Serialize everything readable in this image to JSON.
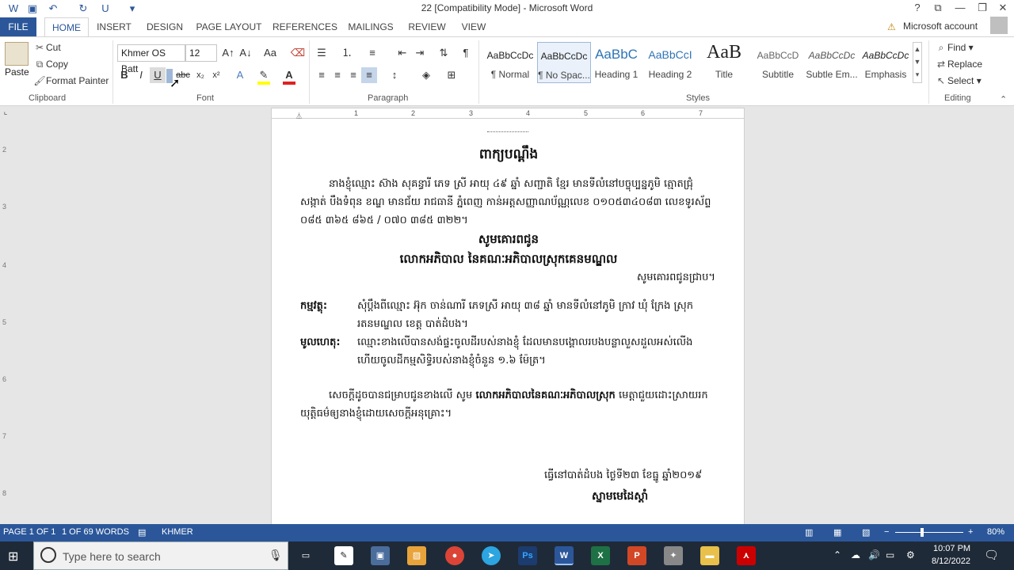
{
  "window": {
    "title": "22 [Compatibility Mode] - Microsoft Word",
    "help": "?",
    "account": "Microsoft account"
  },
  "tabs": [
    {
      "label": "FILE"
    },
    {
      "label": "HOME"
    },
    {
      "label": "INSERT"
    },
    {
      "label": "DESIGN"
    },
    {
      "label": "PAGE LAYOUT"
    },
    {
      "label": "REFERENCES"
    },
    {
      "label": "MAILINGS"
    },
    {
      "label": "REVIEW"
    },
    {
      "label": "VIEW"
    }
  ],
  "clipboard": {
    "paste": "Paste",
    "cut": "Cut",
    "copy": "Copy",
    "format_painter": "Format Painter",
    "group": "Clipboard"
  },
  "font": {
    "family": "Khmer OS Batt",
    "size": "12",
    "group": "Font",
    "bold": "B",
    "italic": "I",
    "underline": "U",
    "strike": "abc",
    "sub": "x₂",
    "sup": "x²",
    "case": "Aa"
  },
  "paragraph": {
    "group": "Paragraph"
  },
  "styles": {
    "group": "Styles",
    "items": [
      {
        "sample": "AaBbCcDc",
        "name": "¶ Normal"
      },
      {
        "sample": "AaBbCcDc",
        "name": "¶ No Spac..."
      },
      {
        "sample": "AaBbC",
        "name": "Heading 1"
      },
      {
        "sample": "AaBbCcI",
        "name": "Heading 2"
      },
      {
        "sample": "AaB",
        "name": "Title"
      },
      {
        "sample": "AaBbCcD",
        "name": "Subtitle"
      },
      {
        "sample": "AaBbCcDc",
        "name": "Subtle Em..."
      },
      {
        "sample": "AaBbCcDc",
        "name": "Emphasis"
      }
    ]
  },
  "editing": {
    "group": "Editing",
    "find": "Find",
    "replace": "Replace",
    "select": "Select"
  },
  "ruler": {
    "h_ticks": [
      "1",
      "2",
      "3",
      "4",
      "5",
      "6",
      "7"
    ],
    "v_ticks": [
      "2",
      "3",
      "4",
      "5",
      "6",
      "7",
      "8"
    ]
  },
  "document": {
    "title": "ពាក្យបណ្ដឹង",
    "para1_l1": "នាងខ្ញុំឈ្មោះ ស៊ាង សុគន្ធារី ភេទ ស្រី អាយុ ៤៩ ឆ្នាំ សញ្ជាតិ ខ្មែរ មានទីលំនៅបច្ចុប្បន្នភូមិ ត្មោតជ្រុំ",
    "para1_l2": "សង្កាត់ បឹងទំពុន ខណ្ឌ មានជ័យ រាជធានី ភ្នំពេញ កាន់អត្តសញ្ញាណប័ណ្ណលេខ ០១០៥៣៤០៨៣ លេខទូរស័ព្ទ",
    "para1_l3": "០៨៥ ៣៦៥ ៨៦៥ / ០៧០ ៣៨៥ ៣២២។",
    "respect_to": "សូមគោរពជូន",
    "addressee": "លោកអភិបាល នៃគណៈអភិបាលស្រុកគេនមណ្ឌល",
    "for_info": "សូមគោរពជូនជ្រាប។",
    "subject_label": "កម្មវត្ថុ:",
    "subject_l1": "សុំប្ដឹងពីឈ្មោះ អ៊ុក ចាន់ណារី ភេទស្រី អាយុ ៣៨ ឆ្នាំ មានទីលំនៅភូមិ ក្រាវ ឃុំ ក្រែង ស្រុក",
    "subject_l2": "រតនមណ្ឌល ខេត្ត បាត់ដំបង។",
    "reason_label": "មូលហេតុ:",
    "reason_l1": "ឈ្មោះខាងលើបានសង់ផ្ទះចូលដីរបស់នាងខ្ញុំ ដែលមានបង្គោលរបងបន្លាលួសដួលអស់លើង",
    "reason_l2": "ហើយចូលដីកម្មសិទ្ធិរបស់នាងខ្ញុំចំនួន ១.៦ ម៉ែត្រ។",
    "closing_l1a": "សេចក្ដីដូចបានជម្រាបជូនខាងលើ សូម",
    "closing_l1b": "លោកអភិបាលនៃគណៈអភិបាលស្រុក",
    "closing_l1c": "មេត្តាជួយដោះស្រាយរក",
    "closing_l2": "យុត្តិធម៌ឲ្យនាងខ្ញុំដោយសេចក្ដីអនុគ្រោះ។",
    "date_line": "ធ្វើនៅបាត់ដំបង ថ្ងៃទី២៣ ខែធ្នូ ឆ្នាំ២០១៩",
    "signature": "ស្នាមមេដៃស្ដាំ"
  },
  "status": {
    "page": "PAGE 1 OF 1",
    "words": "1 OF 69 WORDS",
    "language": "KHMER",
    "zoom": "80%"
  },
  "taskbar": {
    "search_placeholder": "Type here to search",
    "time": "10:07 PM",
    "date": "8/12/2022",
    "apps": [
      {
        "label": "Ps",
        "color": "#1c3b6e"
      },
      {
        "label": "W",
        "color": "#2b579a"
      },
      {
        "label": "X",
        "color": "#1e7145"
      },
      {
        "label": "P",
        "color": "#d24726"
      }
    ]
  }
}
